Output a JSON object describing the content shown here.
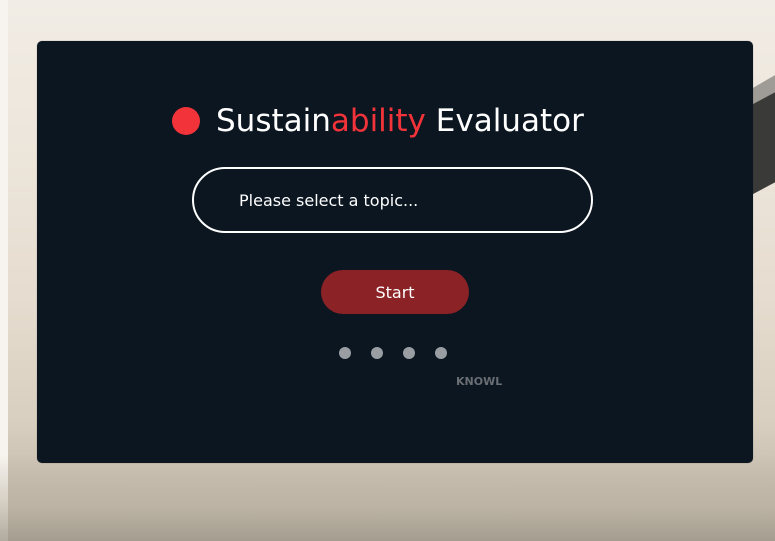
{
  "app": {
    "title_parts": {
      "prefix": "Sustain",
      "accent": "ability",
      "suffix": " Evaluator"
    },
    "accent_color": "#f2333a",
    "panel_color": "#0b1620"
  },
  "topic_select": {
    "placeholder": "Please select a topic..."
  },
  "start_button": {
    "label": "Start",
    "color": "#8b2226"
  },
  "progress": {
    "dots": [
      "step-1",
      "step-2",
      "step-3",
      "step-4"
    ]
  },
  "ticker": {
    "text": "KNOWL"
  }
}
